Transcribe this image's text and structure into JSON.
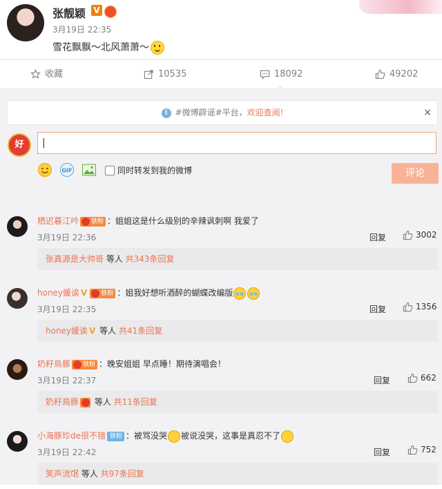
{
  "post": {
    "username": "张靓颖",
    "v_label": "V",
    "time": "3月19日 22:35",
    "text": "雪花飘飘～北风萧萧～"
  },
  "actions": {
    "collect": "收藏",
    "forward_count": "10535",
    "comment_count": "18092",
    "like_count": "49202"
  },
  "notice": {
    "tag_text": "#微博辟谣#平台，",
    "link_text": "欢迎查阅!",
    "close": "×"
  },
  "composer": {
    "my_avatar_text": "好",
    "input_value": "|",
    "sync_label": "同时转发到我的微博",
    "submit": "评论"
  },
  "comments": [
    {
      "name": "栖迟暮江吟",
      "badge": "铁粉",
      "text": "：姐姐这是什么级别的辛辣讽刺啊 我爱了",
      "time": "3月19日 22:36",
      "reply": "回复",
      "likes": "3002",
      "sub_who": "张真源是大帅哥",
      "sub_mid": " 等人 ",
      "sub_cnt": "共343条回复"
    },
    {
      "name": "honey媛诶",
      "v_label": "V",
      "badge": "铁粉",
      "text": "：姐我好想听酒醉的蝴蝶改编版",
      "time": "3月19日 22:35",
      "reply": "回复",
      "likes": "1356",
      "sub_who": "honey媛诶",
      "sub_mid": " 等人 ",
      "sub_cnt": "共41条回复"
    },
    {
      "name": "奶籽鳥豚",
      "badge": "铁粉",
      "text": "：晚安姐姐 早点睡！期待演唱会！",
      "time": "3月19日 22:37",
      "reply": "回复",
      "likes": "662",
      "sub_who": "奶籽鳥豚",
      "sub_mid": " 等人 ",
      "sub_cnt": "共11条回复"
    },
    {
      "name": "小海豚珍de很不错",
      "badge": "铁粉",
      "text_a": "：被骂没哭",
      "text_b": "被说没哭，这事是真忍不了",
      "time": "3月19日 22:42",
      "reply": "回复",
      "likes": "752",
      "sub_who": "笑声流氓",
      "sub_mid": " 等人 ",
      "sub_cnt": "共97条回复"
    }
  ],
  "colors": {
    "accent": "#eb7350",
    "bg": "#f2f2f5"
  }
}
